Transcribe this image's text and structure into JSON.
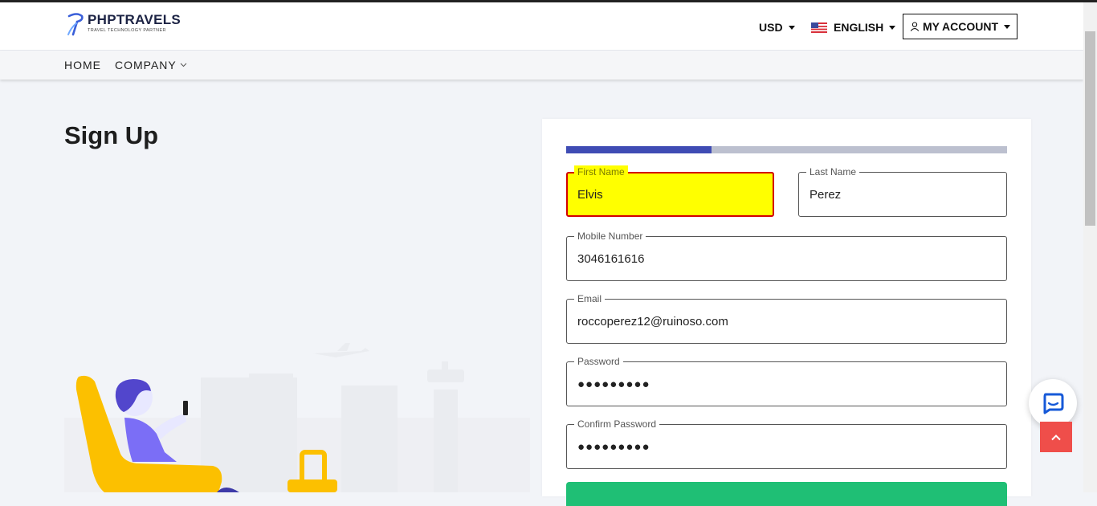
{
  "header": {
    "logo_title": "PHPTRAVELS",
    "logo_subtitle": "TRAVEL TECHNOLOGY PARTNER",
    "currency": "USD",
    "language": "ENGLISH",
    "account_label": "MY ACCOUNT"
  },
  "nav": {
    "items": [
      {
        "label": "HOME"
      },
      {
        "label": "COMPANY"
      }
    ]
  },
  "page": {
    "title": "Sign Up"
  },
  "form": {
    "progress_fraction": 0.33,
    "first_name": {
      "label": "First Name",
      "value": "Elvis"
    },
    "last_name": {
      "label": "Last Name",
      "value": "Perez"
    },
    "mobile": {
      "label": "Mobile Number",
      "value": "3046161616"
    },
    "email": {
      "label": "Email",
      "value": "roccoperez12@ruinoso.com"
    },
    "password": {
      "label": "Password",
      "value": "●●●●●●●●●"
    },
    "confirm_password": {
      "label": "Confirm Password",
      "value": "●●●●●●●●●"
    }
  },
  "colors": {
    "brand_blue": "#3f4cb4",
    "progress_track": "#bcc0cf",
    "invalid_bg": "#ffff00",
    "invalid_border": "#d30000",
    "submit_green": "#1fbf75",
    "back_to_top": "#ef4e4a"
  },
  "icons": {
    "logo": "phptravels-logo-icon",
    "flag": "us-flag-icon",
    "user": "user-icon",
    "chat": "chat-icon",
    "back_to_top": "chevron-up-icon"
  }
}
